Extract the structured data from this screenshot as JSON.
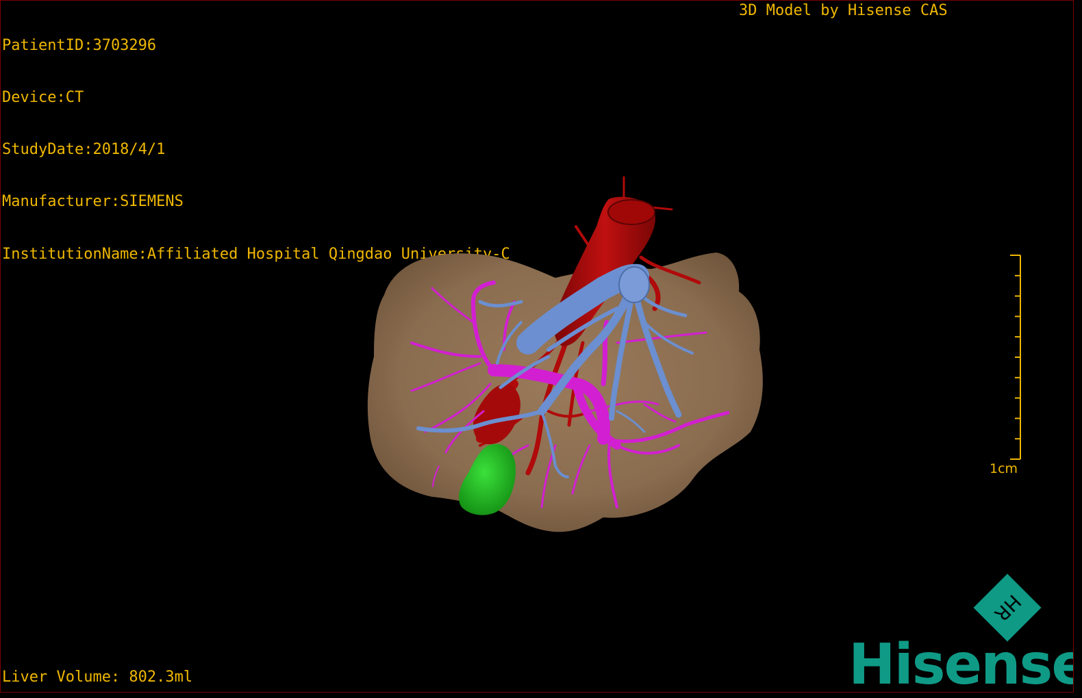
{
  "overlay": {
    "patient_id": "PatientID:3703296",
    "device": "Device:CT",
    "study_date": "StudyDate:2018/4/1",
    "manufacturer": "Manufacturer:SIEMENS",
    "institution": "InstitutionName:Affiliated Hospital Qingdao University-C",
    "brand_caption": "3D Model by Hisense CAS",
    "liver_volume": "Liver Volume: 802.3ml"
  },
  "scale_bar": {
    "label": "1cm",
    "tick_count": 10
  },
  "logo": {
    "mark_letters": "HR",
    "wordmark": "Hisense",
    "color": "#0f9a86"
  },
  "colors": {
    "overlay_text": "#f0b800",
    "liver": "#8a6c4f",
    "artery": "#b00a0a",
    "portal_vein": "#6b8fd0",
    "hepatic_vein": "#d21fd2",
    "gallbladder": "#1fb81f",
    "background": "#000000"
  }
}
